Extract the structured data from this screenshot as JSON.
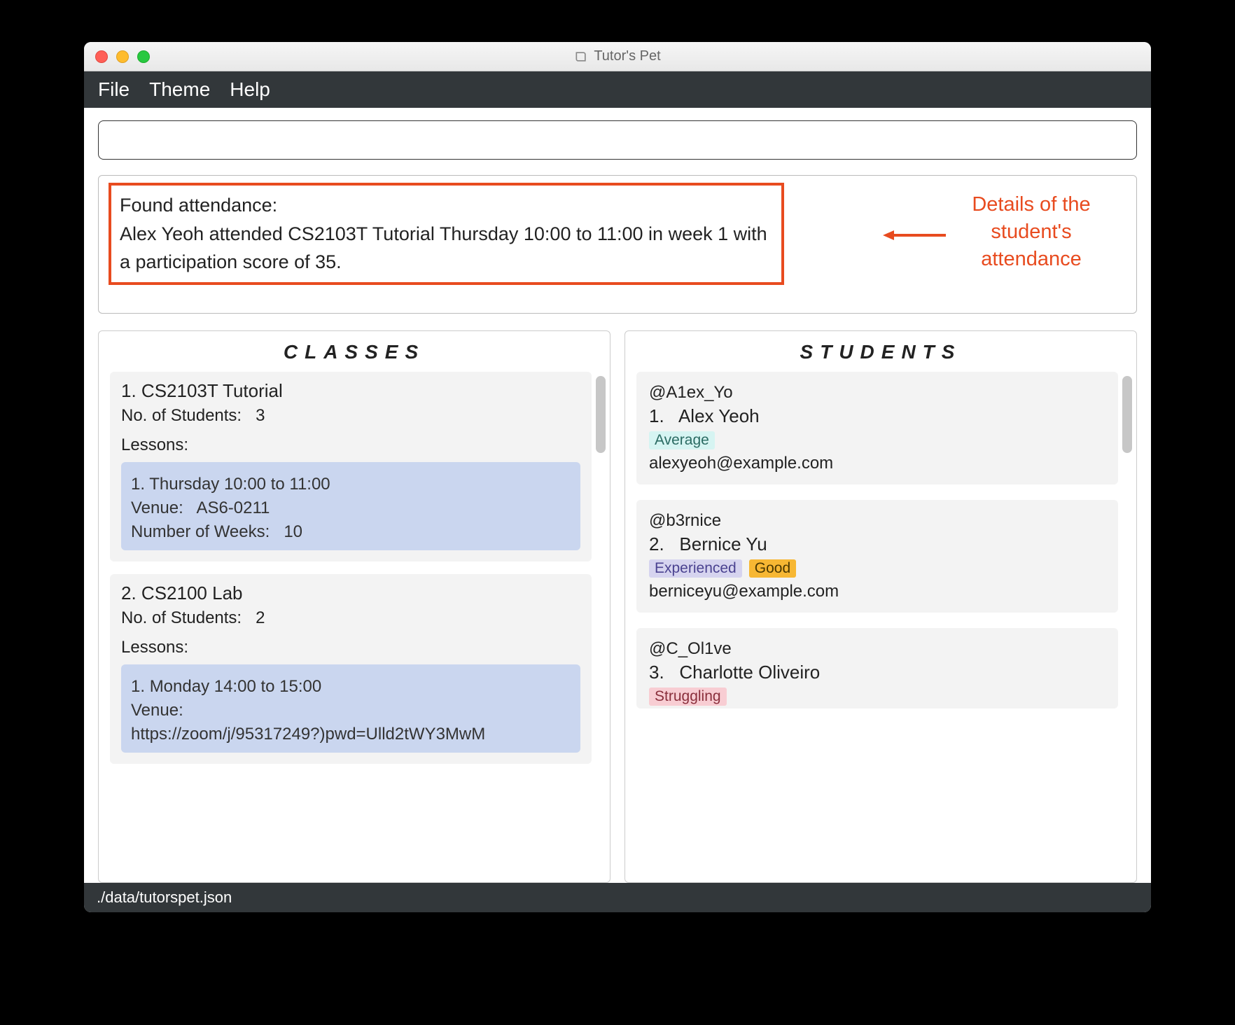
{
  "window": {
    "title": "Tutor's Pet"
  },
  "menu": {
    "file": "File",
    "theme": "Theme",
    "help": "Help"
  },
  "command": {
    "value": ""
  },
  "result": {
    "line1": "Found attendance:",
    "line2": "Alex Yeoh attended CS2103T Tutorial Thursday 10:00 to 11:00 in week 1 with a participation score of 35."
  },
  "annotation": {
    "text": "Details of the student's attendance"
  },
  "classesPanel": {
    "heading": "CLASSES",
    "items": [
      {
        "index": "1.",
        "title": "CS2103T Tutorial",
        "students_label": "No. of Students:",
        "students_count": "3",
        "lessons_label": "Lessons:",
        "lessons": [
          {
            "index": "1.",
            "time": "Thursday 10:00 to 11:00",
            "venue_label": "Venue:",
            "venue": "AS6-0211",
            "weeks_label": "Number of Weeks:",
            "weeks": "10"
          }
        ]
      },
      {
        "index": "2.",
        "title": "CS2100 Lab",
        "students_label": "No. of Students:",
        "students_count": "2",
        "lessons_label": "Lessons:",
        "lessons": [
          {
            "index": "1.",
            "time": "Monday 14:00 to 15:00",
            "venue_label": "Venue:",
            "venue": "https://zoom/j/95317249?)pwd=Ulld2tWY3MwM",
            "weeks_label": "",
            "weeks": ""
          }
        ]
      }
    ]
  },
  "studentsPanel": {
    "heading": "STUDENTS",
    "items": [
      {
        "handle": "@A1ex_Yo",
        "index": "1.",
        "name": "Alex Yeoh",
        "tags": [
          {
            "label": "Average",
            "cls": "average"
          }
        ],
        "email": "alexyeoh@example.com"
      },
      {
        "handle": "@b3rnice",
        "index": "2.",
        "name": "Bernice Yu",
        "tags": [
          {
            "label": "Experienced",
            "cls": "experienced"
          },
          {
            "label": "Good",
            "cls": "good"
          }
        ],
        "email": "berniceyu@example.com"
      },
      {
        "handle": "@C_Ol1ve",
        "index": "3.",
        "name": "Charlotte Oliveiro",
        "tags": [
          {
            "label": "Struggling",
            "cls": "struggling"
          }
        ],
        "email": ""
      }
    ]
  },
  "statusbar": {
    "path": "./data/tutorspet.json"
  }
}
